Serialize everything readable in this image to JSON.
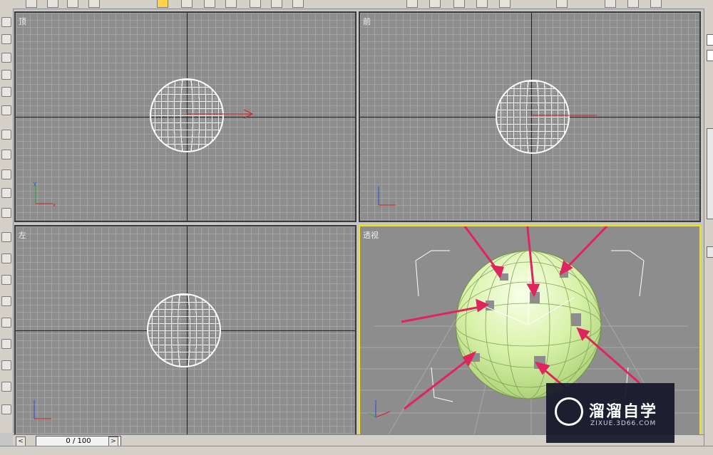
{
  "viewports": {
    "top": {
      "label": "顶"
    },
    "front": {
      "label": "前"
    },
    "left": {
      "label": "左"
    },
    "perspective": {
      "label": "透视"
    }
  },
  "timeline": {
    "frame_counter": "0 / 100",
    "prev_label": "<",
    "next_label": ">"
  },
  "watermark": {
    "title": "溜溜自学",
    "subtitle": "ZIXUE.3D66.COM"
  },
  "colors": {
    "viewport_bg": "#8d8d8d",
    "grid": "#a3a3a3",
    "active_border": "#f3e600",
    "sphere_shaded": "#d8f2a8",
    "annotation_arrow": "#e0245e",
    "x_axis": "#d42020",
    "y_axis": "#20b020",
    "z_axis": "#2050e0"
  },
  "icons": [
    "select-icon",
    "move-icon",
    "rotate-icon",
    "scale-icon",
    "undo-icon",
    "redo-icon",
    "link-icon",
    "camera-icon"
  ]
}
